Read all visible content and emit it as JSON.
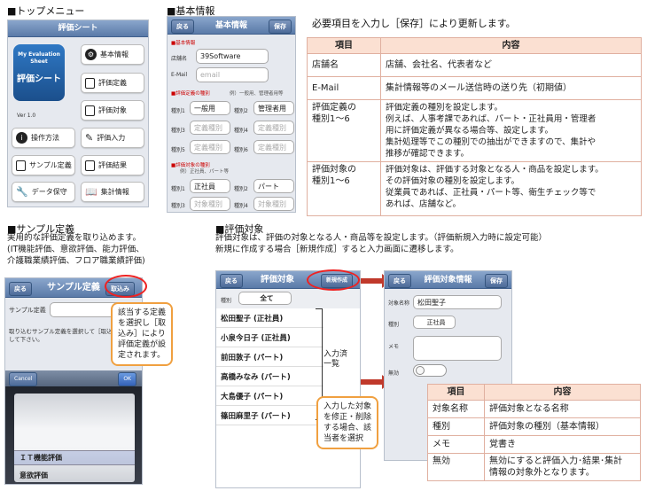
{
  "sections": {
    "top_menu": "■トップメニュー",
    "basic_info": "■基本情報",
    "sample": "■サンプル定義",
    "target": "■評価対象"
  },
  "basic_info_desc": "必要項目を入力し［保存］により更新します。",
  "sample_desc": [
    "実用的な評価定義を取り込めます。",
    "(IT機能評価、意欲評価、能力評価、",
    "介護職業績評価、フロア職業績評価)"
  ],
  "target_desc": [
    "評価対象は、評価の対象となる人・商品等を設定します。（評価新規入力時に設定可能）",
    "新規に作成する場合［新規作成］すると入力画面に遷移します。"
  ],
  "top_screen": {
    "title": "評価シート",
    "logo_lines": [
      "My Evaluation",
      "Sheet"
    ],
    "logo_big": "評価シート",
    "version": "Ver 1.0",
    "buttons": [
      "基本情報",
      "評価定義",
      "評価対象",
      "操作方法",
      "評価入力",
      "サンプル定義",
      "評価結果",
      "データ保守",
      "集計情報"
    ]
  },
  "basic_screen": {
    "title": "基本情報",
    "back": "戻る",
    "save": "保存",
    "sec_basic": "■基本情報",
    "store_label": "店舗名",
    "store_value": "39Software",
    "email_label": "E-Mail",
    "email_ph": "email",
    "sec_def": "■評価定義の種別",
    "sec_def_note": "例）一般用、管理者用等",
    "kinds": [
      "種別1",
      "種別2",
      "種別3",
      "種別4",
      "種別5",
      "種別6"
    ],
    "kind_values": [
      "一般用",
      "管理者用",
      "定義種別",
      "定義種別",
      "定義種別",
      "定義種別"
    ],
    "sec_target": "■評価対象の種別",
    "sec_target_note": "例）正社員、パート等",
    "target_values": [
      "正社員",
      "パート",
      "対象種別",
      "対象種別"
    ]
  },
  "info_table": {
    "headers": [
      "項目",
      "内容"
    ],
    "rows": [
      {
        "item": [
          "店舗名"
        ],
        "content": [
          "店舗、会社名、代表者など"
        ]
      },
      {
        "item": [
          "E-Mail"
        ],
        "content": [
          "集計情報等のメール送信時の送り先（初期値）"
        ]
      },
      {
        "item": [
          "評価定義の",
          "種別1～6"
        ],
        "content": [
          "評価定義の種別を設定します。",
          "例えば、人事考課であれば、パート・正社員用・管理者",
          "用に評価定義が異なる場合等、設定します。",
          "集計処理等でこの種別での抽出ができますので、集計や",
          "推移が確認できます。"
        ]
      },
      {
        "item": [
          "評価対象の",
          "種別1～6"
        ],
        "content": [
          "評価対象は、評価する対象となる人・商品を設定します。",
          "その評価対象の種別を設定します。",
          "従業員であれば、正社員・パート等、衛生チェック等で",
          "あれば、店舗など。"
        ]
      }
    ]
  },
  "sample_screen": {
    "title": "サンプル定義",
    "back": "戻る",
    "import": "取込み",
    "field_label": "サンプル定義",
    "hint": [
      "取り込むサンプル定義を選択して［取込",
      "して下さい。"
    ],
    "cancel": "Cancel",
    "ok": "OK",
    "picker_items": [
      "ＩＴ機能評価",
      "意欲評価"
    ]
  },
  "sample_callout": [
    "該当する定義",
    "を選択し［取",
    "込み］により",
    "評価定義が設",
    "定されます。"
  ],
  "target_screen": {
    "title": "評価対象",
    "back": "戻る",
    "new": "新規作成",
    "kind_label": "種別",
    "kind_value": "全て",
    "people": [
      "松田聖子 (正社員)",
      "小泉今日子 (正社員)",
      "前田敦子 (パート)",
      "高橋みなみ (パート)",
      "大島優子 (パート)",
      "篠田麻里子 (パート)"
    ]
  },
  "list_note": [
    "入力済",
    "一覧"
  ],
  "target_callout": [
    "入力した対象",
    "を修正・削除",
    "する場合、該",
    "当者を選択"
  ],
  "target_info_screen": {
    "title": "評価対象情報",
    "back": "戻る",
    "save": "保存",
    "name_label": "対象名称",
    "name_value": "松田聖子",
    "kind_label": "種別",
    "kind_value": "正社員",
    "memo_label": "メモ",
    "disable_label": "無効"
  },
  "target_table": {
    "headers": [
      "項目",
      "内容"
    ],
    "rows": [
      {
        "item": "対象名称",
        "content": [
          "評価対象となる名称"
        ]
      },
      {
        "item": "種別",
        "content": [
          "評価対象の種別（基本情報）"
        ]
      },
      {
        "item": "メモ",
        "content": [
          "覚書き"
        ]
      },
      {
        "item": "無効",
        "content": [
          "無効にすると評価入力･結果･集計",
          "情報の対象外となります。"
        ]
      }
    ]
  }
}
